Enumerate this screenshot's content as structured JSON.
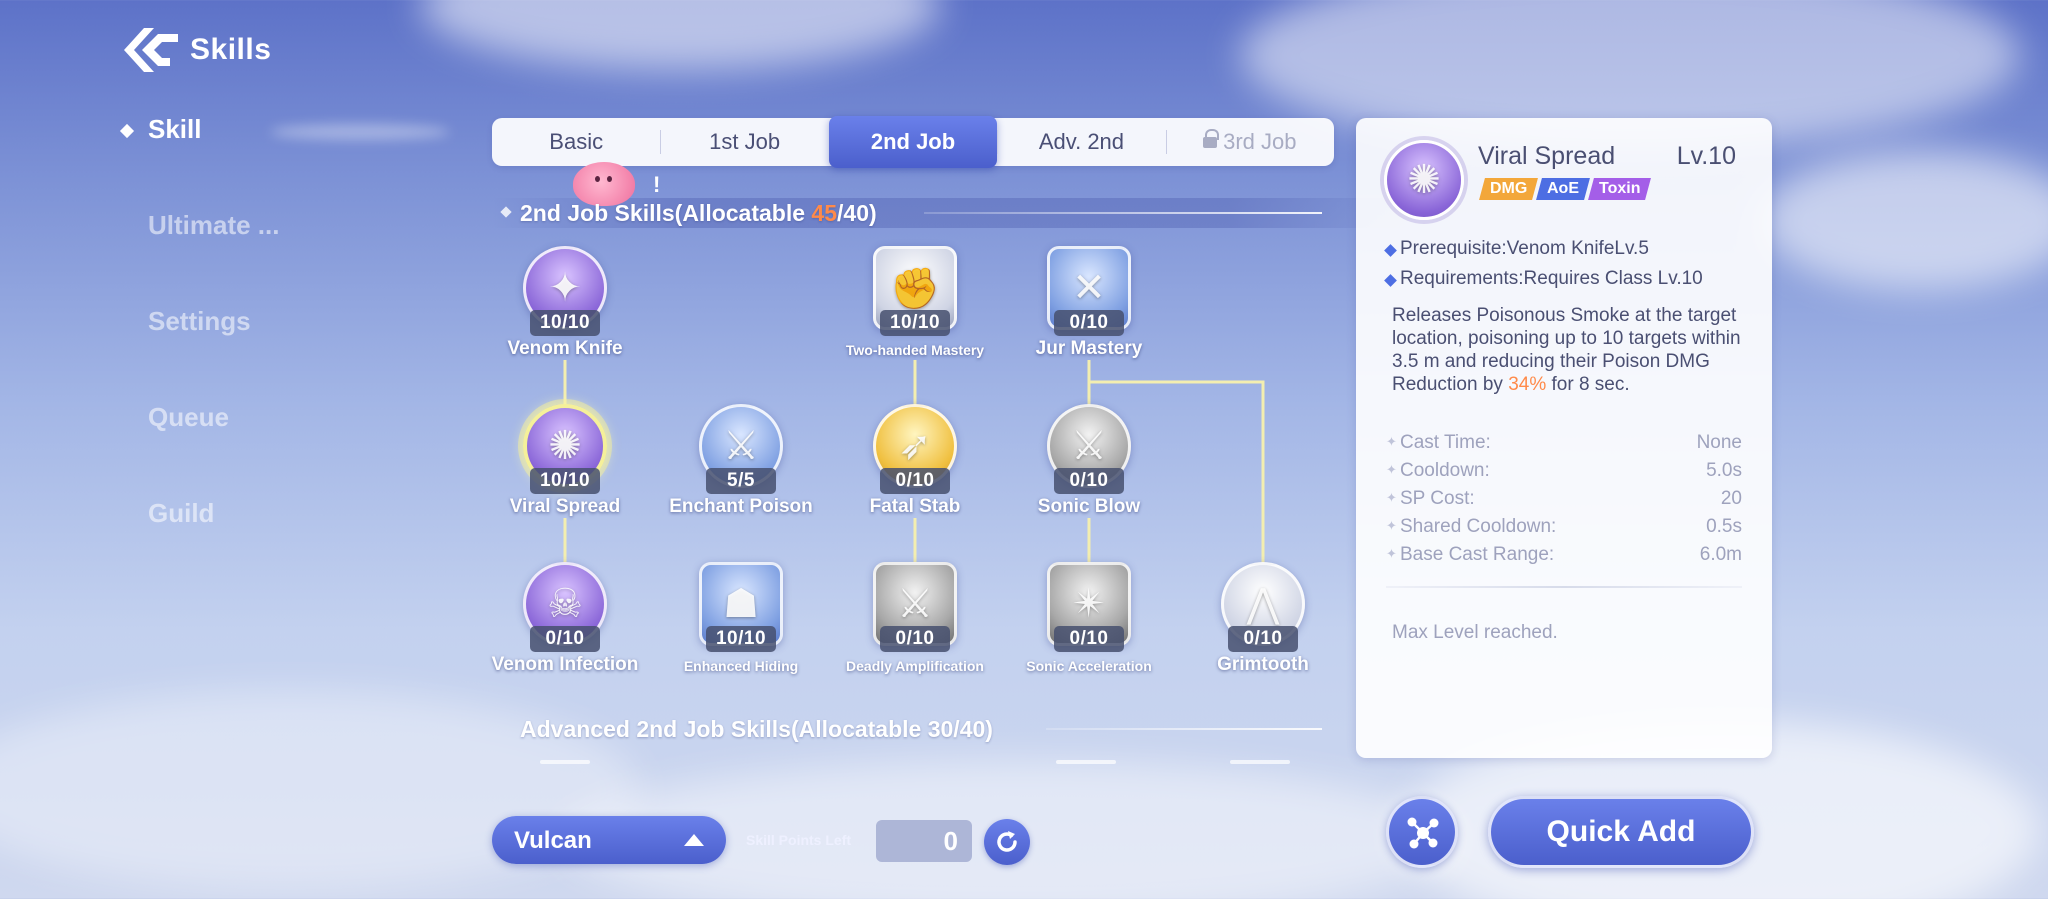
{
  "header": {
    "title": "Skills"
  },
  "nav": {
    "items": [
      {
        "label": "Skill"
      },
      {
        "label": "Ultimate ..."
      },
      {
        "label": "Settings"
      },
      {
        "label": "Queue"
      },
      {
        "label": "Guild"
      }
    ]
  },
  "tabs": [
    {
      "label": "Basic"
    },
    {
      "label": "1st Job"
    },
    {
      "label": "2nd Job"
    },
    {
      "label": "Adv. 2nd"
    },
    {
      "label": "3rd Job"
    }
  ],
  "notice": {
    "mark": "!"
  },
  "sections": {
    "job2": {
      "prefix": "2nd Job Skills(Allocatable ",
      "used": "45",
      "suffix": "/40)"
    },
    "adv2": {
      "title": "Advanced 2nd Job Skills(Allocatable 30/40)"
    }
  },
  "skills": [
    {
      "name": "Venom Knife",
      "level": "10/10",
      "icon": "venom-knife-icon"
    },
    {
      "name": "Two-handed Mastery",
      "level": "10/10",
      "icon": "two-handed-mastery-icon"
    },
    {
      "name": "Jur Mastery",
      "level": "0/10",
      "icon": "jur-mastery-icon"
    },
    {
      "name": "Viral Spread",
      "level": "10/10",
      "icon": "viral-spread-icon"
    },
    {
      "name": "Enchant Poison",
      "level": "5/5",
      "icon": "enchant-poison-icon"
    },
    {
      "name": "Fatal Stab",
      "level": "0/10",
      "icon": "fatal-stab-icon"
    },
    {
      "name": "Sonic Blow",
      "level": "0/10",
      "icon": "sonic-blow-icon"
    },
    {
      "name": "Venom Infection",
      "level": "0/10",
      "icon": "venom-infection-icon"
    },
    {
      "name": "Enhanced Hiding",
      "level": "10/10",
      "icon": "enhanced-hiding-icon"
    },
    {
      "name": "Deadly Amplification",
      "level": "0/10",
      "icon": "deadly-amplification-icon"
    },
    {
      "name": "Sonic Acceleration",
      "level": "0/10",
      "icon": "sonic-acceleration-icon"
    },
    {
      "name": "Grimtooth",
      "level": "0/10",
      "icon": "grimtooth-icon"
    }
  ],
  "detail": {
    "name": "Viral Spread",
    "level": "Lv.10",
    "tags": [
      "DMG",
      "AoE",
      "Toxin"
    ],
    "prerequisite": "Prerequisite:Venom KnifeLv.5",
    "requirements": "Requirements:Requires Class Lv.10",
    "desc_a": "Releases Poisonous Smoke at the target location, poisoning up to 10 targets within 3.5 m and reducing their Poison DMG Reduction by ",
    "desc_hi": "34%",
    "desc_b": " for 8 sec.",
    "stats": [
      {
        "key": "Cast Time:",
        "value": "None"
      },
      {
        "key": "Cooldown:",
        "value": "5.0s"
      },
      {
        "key": "SP Cost:",
        "value": "20"
      },
      {
        "key": "Shared Cooldown:",
        "value": "0.5s"
      },
      {
        "key": "Base Cast Range:",
        "value": "6.0m"
      }
    ],
    "footer": "Max Level reached."
  },
  "bottom": {
    "class_select": "Vulcan",
    "sp_label": "Skill Points Left",
    "sp_value": "0",
    "quick_add": "Quick Add"
  },
  "colors": {
    "accent": "#4b5fcc",
    "highlight": "#ff8a4a",
    "selected_ring": "#f5f09a"
  }
}
